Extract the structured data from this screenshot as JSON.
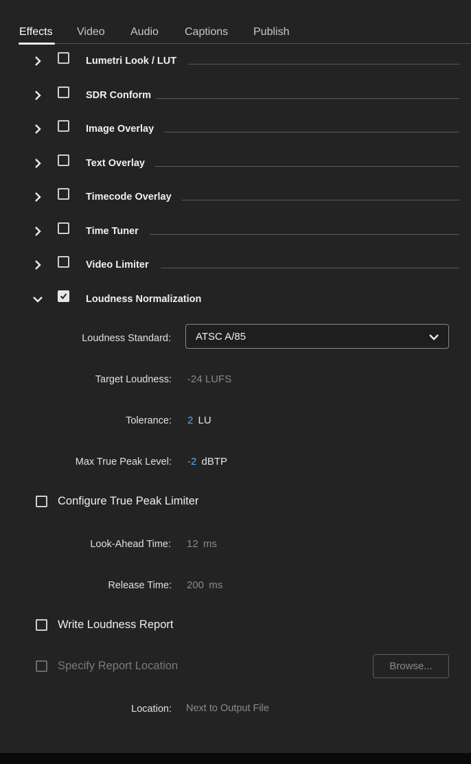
{
  "tabs": [
    {
      "label": "Effects",
      "active": true
    },
    {
      "label": "Video",
      "active": false
    },
    {
      "label": "Audio",
      "active": false
    },
    {
      "label": "Captions",
      "active": false
    },
    {
      "label": "Publish",
      "active": false
    }
  ],
  "effects": [
    {
      "label": "Lumetri Look / LUT",
      "expanded": false,
      "checked": false
    },
    {
      "label": "SDR Conform",
      "expanded": false,
      "checked": false
    },
    {
      "label": "Image Overlay",
      "expanded": false,
      "checked": false
    },
    {
      "label": "Text Overlay",
      "expanded": false,
      "checked": false
    },
    {
      "label": "Timecode Overlay",
      "expanded": false,
      "checked": false
    },
    {
      "label": "Time Tuner",
      "expanded": false,
      "checked": false
    },
    {
      "label": "Video Limiter",
      "expanded": false,
      "checked": false
    },
    {
      "label": "Loudness Normalization",
      "expanded": true,
      "checked": true
    }
  ],
  "loudness": {
    "standard_label": "Loudness Standard:",
    "standard_value": "ATSC A/85",
    "target_label": "Target Loudness:",
    "target_value": "-24",
    "target_unit": "LUFS",
    "tolerance_label": "Tolerance:",
    "tolerance_value": "2",
    "tolerance_unit": "LU",
    "max_peak_label": "Max True Peak Level:",
    "max_peak_value": "-2",
    "max_peak_unit": "dBTP",
    "configure_limiter_label": "Configure True Peak Limiter",
    "configure_limiter_checked": false,
    "lookahead_label": "Look-Ahead Time:",
    "lookahead_value": "12",
    "lookahead_unit": "ms",
    "release_label": "Release Time:",
    "release_value": "200",
    "release_unit": "ms",
    "write_report_label": "Write Loudness Report",
    "write_report_checked": false,
    "specify_location_label": "Specify Report Location",
    "specify_location_checked": false,
    "browse_label": "Browse...",
    "location_label": "Location:",
    "location_value": "Next to Output File"
  },
  "icons": {
    "collapsed": "chevron-right-icon",
    "expanded": "chevron-down-icon",
    "dropdown": "chevron-down-icon",
    "check": "checkmark-icon"
  },
  "colors": {
    "background": "#232323",
    "accent_blue": "#5aa6f0",
    "text": "#efefef",
    "dim_text": "#8a8a8a"
  }
}
